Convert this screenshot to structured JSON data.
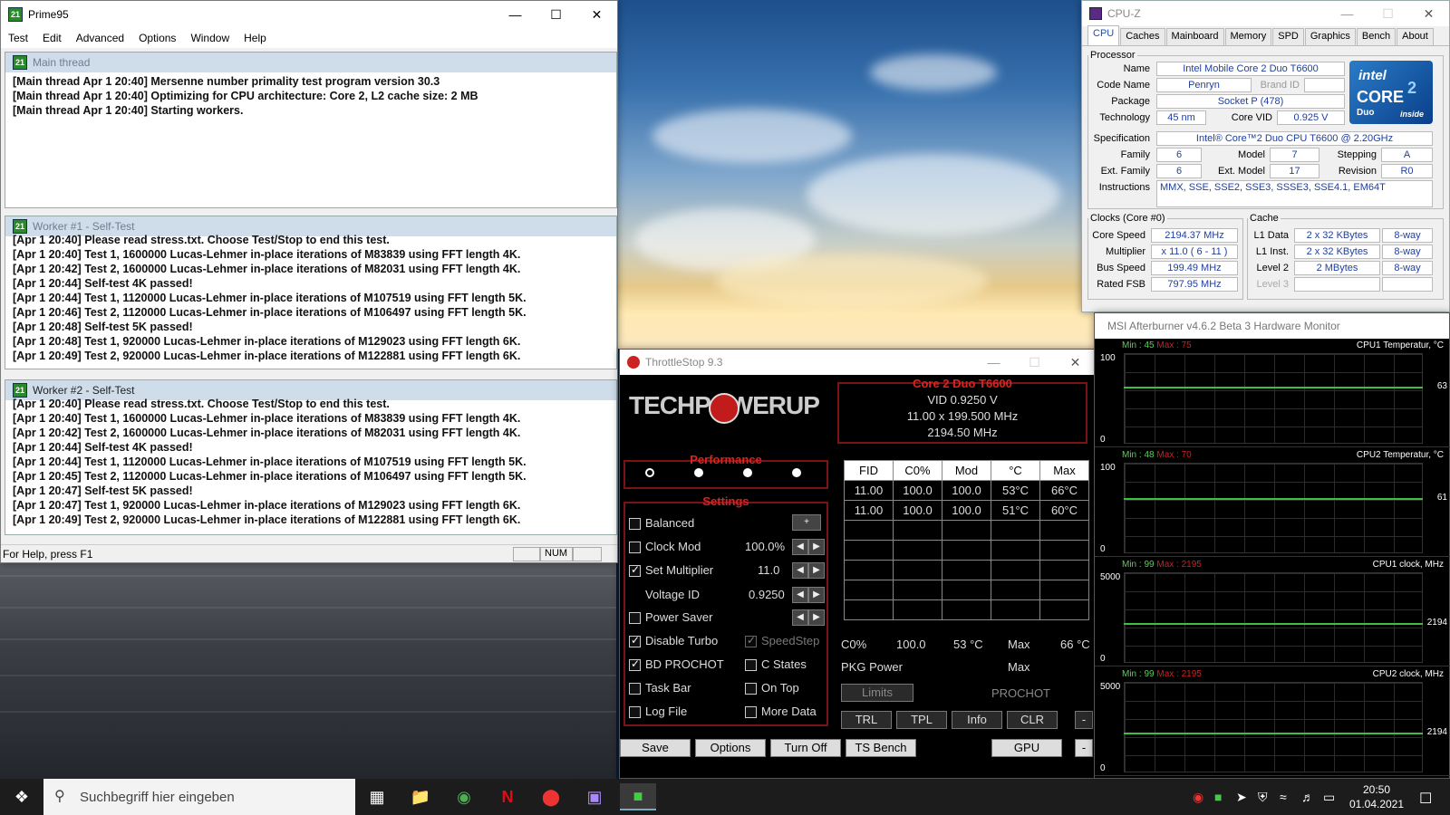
{
  "prime95": {
    "title": "Prime95",
    "menu": [
      "Test",
      "Edit",
      "Advanced",
      "Options",
      "Window",
      "Help"
    ],
    "main": {
      "title": "Main thread",
      "lines": [
        "[Main thread Apr 1 20:40] Mersenne number primality test program version 30.3",
        "[Main thread Apr 1 20:40] Optimizing for CPU architecture: Core 2, L2 cache size: 2 MB",
        "[Main thread Apr 1 20:40] Starting workers."
      ]
    },
    "worker1": {
      "title": "Worker #1 - Self-Test",
      "lines": [
        "[Apr 1 20:40] Please read stress.txt.  Choose Test/Stop to end this test.",
        "[Apr 1 20:40] Test 1, 1600000 Lucas-Lehmer in-place iterations of M83839 using FFT length 4K.",
        "[Apr 1 20:42] Test 2, 1600000 Lucas-Lehmer in-place iterations of M82031 using FFT length 4K.",
        "[Apr 1 20:44] Self-test 4K passed!",
        "[Apr 1 20:44] Test 1, 1120000 Lucas-Lehmer in-place iterations of M107519 using FFT length 5K.",
        "[Apr 1 20:46] Test 2, 1120000 Lucas-Lehmer in-place iterations of M106497 using FFT length 5K.",
        "[Apr 1 20:48] Self-test 5K passed!",
        "[Apr 1 20:48] Test 1, 920000 Lucas-Lehmer in-place iterations of M129023 using FFT length 6K.",
        "[Apr 1 20:49] Test 2, 920000 Lucas-Lehmer in-place iterations of M122881 using FFT length 6K."
      ]
    },
    "worker2": {
      "title": "Worker #2 - Self-Test",
      "lines": [
        "[Apr 1 20:40] Please read stress.txt.  Choose Test/Stop to end this test.",
        "[Apr 1 20:40] Test 1, 1600000 Lucas-Lehmer in-place iterations of M83839 using FFT length 4K.",
        "[Apr 1 20:42] Test 2, 1600000 Lucas-Lehmer in-place iterations of M82031 using FFT length 4K.",
        "[Apr 1 20:44] Self-test 4K passed!",
        "[Apr 1 20:44] Test 1, 1120000 Lucas-Lehmer in-place iterations of M107519 using FFT length 5K.",
        "[Apr 1 20:45] Test 2, 1120000 Lucas-Lehmer in-place iterations of M106497 using FFT length 5K.",
        "[Apr 1 20:47] Self-test 5K passed!",
        "[Apr 1 20:47] Test 1, 920000 Lucas-Lehmer in-place iterations of M129023 using FFT length 6K.",
        "[Apr 1 20:49] Test 2, 920000 Lucas-Lehmer in-place iterations of M122881 using FFT length 6K."
      ]
    },
    "status_help": "For Help, press F1",
    "status_num": "NUM"
  },
  "cpuz": {
    "title": "CPU-Z",
    "tabs": [
      "CPU",
      "Caches",
      "Mainboard",
      "Memory",
      "SPD",
      "Graphics",
      "Bench",
      "About"
    ],
    "processor_legend": "Processor",
    "name_l": "Name",
    "name": "Intel Mobile Core 2 Duo T6600",
    "code_l": "Code Name",
    "code": "Penryn",
    "brand_l": "Brand ID",
    "pkg_l": "Package",
    "pkg": "Socket P (478)",
    "tech_l": "Technology",
    "tech": "45 nm",
    "vid_l": "Core VID",
    "vid": "0.925 V",
    "spec_l": "Specification",
    "spec": "Intel® Core™2 Duo CPU     T6600  @ 2.20GHz",
    "fam_l": "Family",
    "fam": "6",
    "model_l": "Model",
    "model": "7",
    "step_l": "Stepping",
    "step": "A",
    "efam_l": "Ext. Family",
    "efam": "6",
    "emodel_l": "Ext. Model",
    "emodel": "17",
    "rev_l": "Revision",
    "rev": "R0",
    "inst_l": "Instructions",
    "inst": "MMX, SSE, SSE2, SSE3, SSSE3, SSE4.1, EM64T",
    "clocks_legend": "Clocks (Core #0)",
    "cs_l": "Core Speed",
    "cs": "2194.37 MHz",
    "mul_l": "Multiplier",
    "mul": "x 11.0 ( 6 - 11 )",
    "bus_l": "Bus Speed",
    "bus": "199.49 MHz",
    "fsb_l": "Rated FSB",
    "fsb": "797.95 MHz",
    "cache_legend": "Cache",
    "l1d_l": "L1 Data",
    "l1d": "2 x 32 KBytes",
    "l1d_w": "8-way",
    "l1i_l": "L1 Inst.",
    "l1i": "2 x 32 KBytes",
    "l1i_w": "8-way",
    "l2_l": "Level 2",
    "l2": "2 MBytes",
    "l2_w": "8-way",
    "l3_l": "Level 3",
    "logo_top": "intel",
    "logo_mid": "CORE",
    "logo_num": "2",
    "logo_duo": "Duo",
    "logo_inside": "inside"
  },
  "throttlestop": {
    "title": "ThrottleStop 9.3",
    "logo": "TECHPOWERUP",
    "cpu": "Core 2 Duo T6600",
    "vid": "VID  0.9250 V",
    "mult": "11.00 x 199.500 MHz",
    "freq": "2194.50 MHz",
    "performance": "Performance",
    "settings": "Settings",
    "balanced": "Balanced",
    "clockmod": "Clock Mod",
    "clockmod_v": "100.0%",
    "setmult": "Set Multiplier",
    "setmult_v": "11.0",
    "voltage": "Voltage ID",
    "voltage_v": "0.9250",
    "powersaver": "Power Saver",
    "disableturbo": "Disable Turbo",
    "speedstep": "SpeedStep",
    "bdprochot": "BD PROCHOT",
    "cstates": "C States",
    "taskbar": "Task Bar",
    "ontop": "On Top",
    "logfile": "Log File",
    "moredata": "More Data",
    "table_head": [
      "FID",
      "C0%",
      "Mod",
      "°C",
      "Max"
    ],
    "rows": [
      [
        "11.00",
        "100.0",
        "100.0",
        "53°C",
        "66°C"
      ],
      [
        "11.00",
        "100.0",
        "100.0",
        "51°C",
        "60°C"
      ]
    ],
    "c0_l": "C0%",
    "c0_v": "100.0",
    "temp_v": "53 °C",
    "max_l": "Max",
    "max_v": "66 °C",
    "pkg_l": "PKG Power",
    "pkg_max": "Max",
    "limits": "Limits",
    "prochot": "PROCHOT",
    "trl": "TRL",
    "tpl": "TPL",
    "info": "Info",
    "clr": "CLR",
    "dash": "-",
    "save": "Save",
    "options": "Options",
    "turnoff": "Turn Off",
    "tsbench": "TS Bench",
    "gpu": "GPU"
  },
  "afterburner": {
    "title": "MSI Afterburner v4.6.2 Beta 3 Hardware Monitor",
    "graphs": [
      {
        "min": "Min : 45",
        "max": "Max : 75",
        "name": "CPU1 Temperatur, °C",
        "ymax": "100",
        "ymin": "0",
        "cur": "63",
        "level": 0.63
      },
      {
        "min": "Min : 48",
        "max": "Max : 70",
        "name": "CPU2 Temperatur, °C",
        "ymax": "100",
        "ymin": "0",
        "cur": "61",
        "level": 0.61
      },
      {
        "min": "Min : 99",
        "max": "Max : 2195",
        "name": "CPU1 clock, MHz",
        "ymax": "5000",
        "ymin": "0",
        "cur": "2194",
        "level": 0.44
      },
      {
        "min": "Min : 99",
        "max": "Max : 2195",
        "name": "CPU2 clock, MHz",
        "ymax": "5000",
        "ymin": "0",
        "cur": "2194",
        "level": 0.44
      }
    ]
  },
  "taskbar": {
    "search": "Suchbegriff hier eingeben",
    "time": "20:50",
    "date": "01.04.2021"
  }
}
